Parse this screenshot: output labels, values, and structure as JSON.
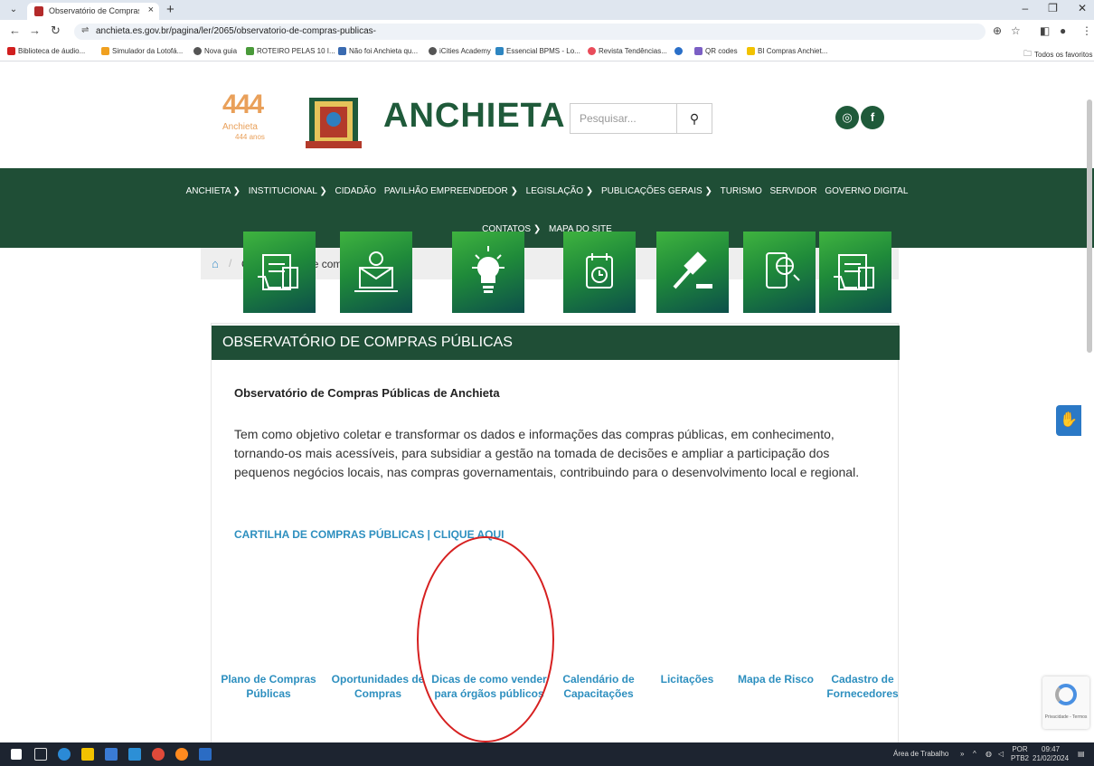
{
  "browser": {
    "tab_title": "Observatório de Compras Públi",
    "tab_close": "×",
    "new_tab": "+",
    "url": "anchieta.es.gov.br/pagina/ler/2065/observatorio-de-compras-publicas-",
    "bookmarks": [
      "Biblioteca de áudio...",
      "Simulador da Lotofá...",
      "Nova guia",
      "ROTEIRO PELAS 10 I...",
      "Não foi Anchieta qu...",
      "iCities Academy",
      "Essencial BPMS - Lo...",
      "Revista Tendências...",
      "QR codes",
      "BI Compras Anchiet..."
    ],
    "bookmarks_folder": "Todos os favoritos"
  },
  "header": {
    "logo_number": "444",
    "logo_city": "Anchieta",
    "logo_years": "444 anos",
    "site_title": "ANCHIETA",
    "search_placeholder": "Pesquisar...",
    "search_icon": "search-icon",
    "social": [
      "instagram-icon",
      "facebook-icon"
    ]
  },
  "nav": {
    "row1": [
      "ANCHIETA ❯",
      "INSTITUCIONAL ❯",
      "CIDADÃO",
      "PAVILHÃO EMPREENDEDOR ❯",
      "LEGISLAÇÃO ❯",
      "PUBLICAÇÕES GERAIS ❯",
      "TURISMO",
      "SERVIDOR",
      "GOVERNO DIGITAL"
    ],
    "row2": [
      "CONTATOS ❯",
      "MAPA DO SITE"
    ]
  },
  "breadcrumb": {
    "separator": "/",
    "current": "Observatorio de compras publicas"
  },
  "content": {
    "heading": "OBSERVATÓRIO DE COMPRAS PÚBLICAS",
    "subtitle": "Observatório de Compras Públicas de Anchieta",
    "description": "Tem como objetivo coletar e transformar os dados e informações das compras públicas, em conhecimento, tornando-os mais acessíveis, para subsidiar a gestão na tomada de decisões e ampliar a participação dos pequenos negócios locais, nas compras governamentais, contribuindo para o desenvolvimento local e regional.",
    "cartilha_link": "CARTILHA DE COMPRAS PÚBLICAS | CLIQUE AQUI",
    "tiles": [
      {
        "label": "Plano de Compras Públicas",
        "icon": "document-cart-icon"
      },
      {
        "label": "Oportunidades de Compras",
        "icon": "laptop-user-icon"
      },
      {
        "label": "Dicas de como vender para órgãos públicos",
        "icon": "lightbulb-icon"
      },
      {
        "label": "Calendário de Capacitações",
        "icon": "calendar-clock-icon"
      },
      {
        "label": "Licitações",
        "icon": "gavel-icon"
      },
      {
        "label": "Mapa de Risco",
        "icon": "phone-globe-icon"
      },
      {
        "label": "Cadastro de Fornecedores",
        "icon": "document-cart-icon"
      }
    ]
  },
  "recaptcha": {
    "text": "Privacidade - Termos"
  },
  "taskbar": {
    "desktop_label": "Área de Trabalho",
    "lang_top": "POR",
    "lang_bottom": "PTB2",
    "time": "09:47",
    "date": "21/02/2024"
  },
  "colors": {
    "brand_green": "#1f4e36",
    "link_blue": "#2d8fbf",
    "highlight_red": "#d62020"
  }
}
